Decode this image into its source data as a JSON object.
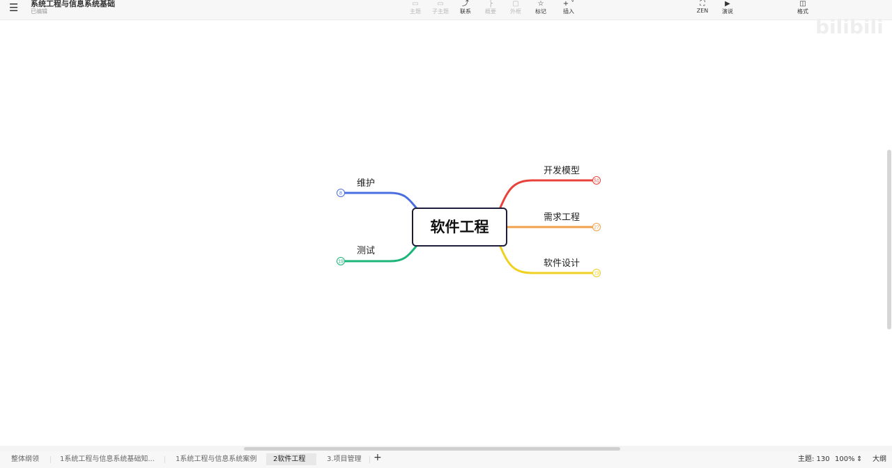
{
  "header": {
    "menu_icon": "hamburger-icon",
    "title": "系统工程与信息系统基础",
    "status": "已编辑"
  },
  "toolbar": [
    {
      "label": "主题",
      "icon": "topic-icon",
      "disabled": true
    },
    {
      "label": "子主题",
      "icon": "subtopic-icon",
      "disabled": true
    },
    {
      "label": "联系",
      "icon": "relation-icon",
      "disabled": false
    },
    {
      "label": "概要",
      "icon": "summary-icon",
      "disabled": true
    },
    {
      "label": "外框",
      "icon": "boundary-icon",
      "disabled": true
    },
    {
      "label": "标记",
      "icon": "star-icon",
      "disabled": false
    },
    {
      "label": "插入",
      "icon": "plus-icon",
      "disabled": false
    }
  ],
  "right_tools": [
    {
      "label": "ZEN",
      "icon": "zen-icon"
    },
    {
      "label": "演说",
      "icon": "play-icon"
    },
    {
      "label": "格式",
      "icon": "format-icon"
    }
  ],
  "watermark": "bilibili",
  "mindmap": {
    "center": "软件工程",
    "branches": [
      {
        "label": "开发模型",
        "count": "51",
        "color": "#e8423a"
      },
      {
        "label": "需求工程",
        "count": "27",
        "color": "#f0a04a"
      },
      {
        "label": "软件设计",
        "count": "19",
        "color": "#f0d020"
      },
      {
        "label": "维护",
        "count": "8",
        "color": "#4a6ee0"
      },
      {
        "label": "测试",
        "count": "19",
        "color": "#1bb57a"
      }
    ]
  },
  "tabs": [
    "整体纲领",
    "1系统工程与信息系统基础知...",
    "1系统工程与信息系统案例",
    "2软件工程",
    "3.项目管理"
  ],
  "add_tab": "+",
  "status": {
    "topics": "主题: 130",
    "zoom": "100%",
    "outline": "大纲"
  }
}
